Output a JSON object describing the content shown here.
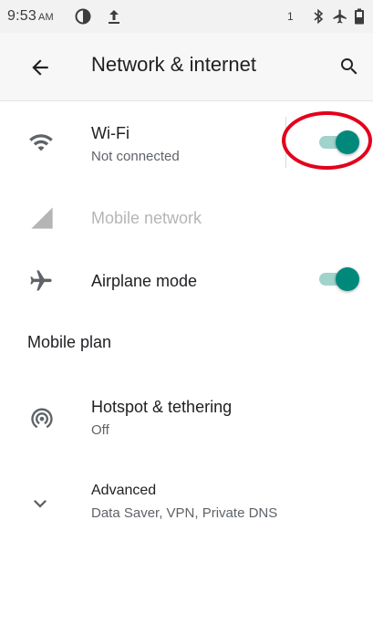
{
  "status_bar": {
    "time": "9:53",
    "ampm": "AM",
    "notification_count": "1",
    "icons": [
      "data-saver-icon",
      "upload-icon",
      "bluetooth-icon",
      "airplane-icon",
      "battery-icon"
    ]
  },
  "app_bar": {
    "title": "Network & internet",
    "icons": [
      "back-arrow-icon",
      "search-icon"
    ]
  },
  "items": {
    "wifi": {
      "title": "Wi-Fi",
      "subtitle": "Not connected",
      "icon": "wifi-icon",
      "toggle_on": true
    },
    "mobile": {
      "title": "Mobile network",
      "icon": "signal-icon",
      "disabled": true
    },
    "airplane": {
      "title": "Airplane mode",
      "icon": "airplane-icon",
      "toggle_on": true
    },
    "hotspot": {
      "title": "Hotspot & tethering",
      "subtitle": "Off",
      "icon": "hotspot-icon"
    },
    "advanced": {
      "title": "Advanced",
      "subtitle": "Data Saver, VPN, Private DNS",
      "icon": "chevron-down-icon"
    }
  },
  "section": {
    "mobile_plan": "Mobile plan"
  },
  "colors": {
    "accent": "#00897b",
    "track": "#9fd3cb",
    "annotation": "#e3001b",
    "disabled": "#b5b5b5"
  }
}
